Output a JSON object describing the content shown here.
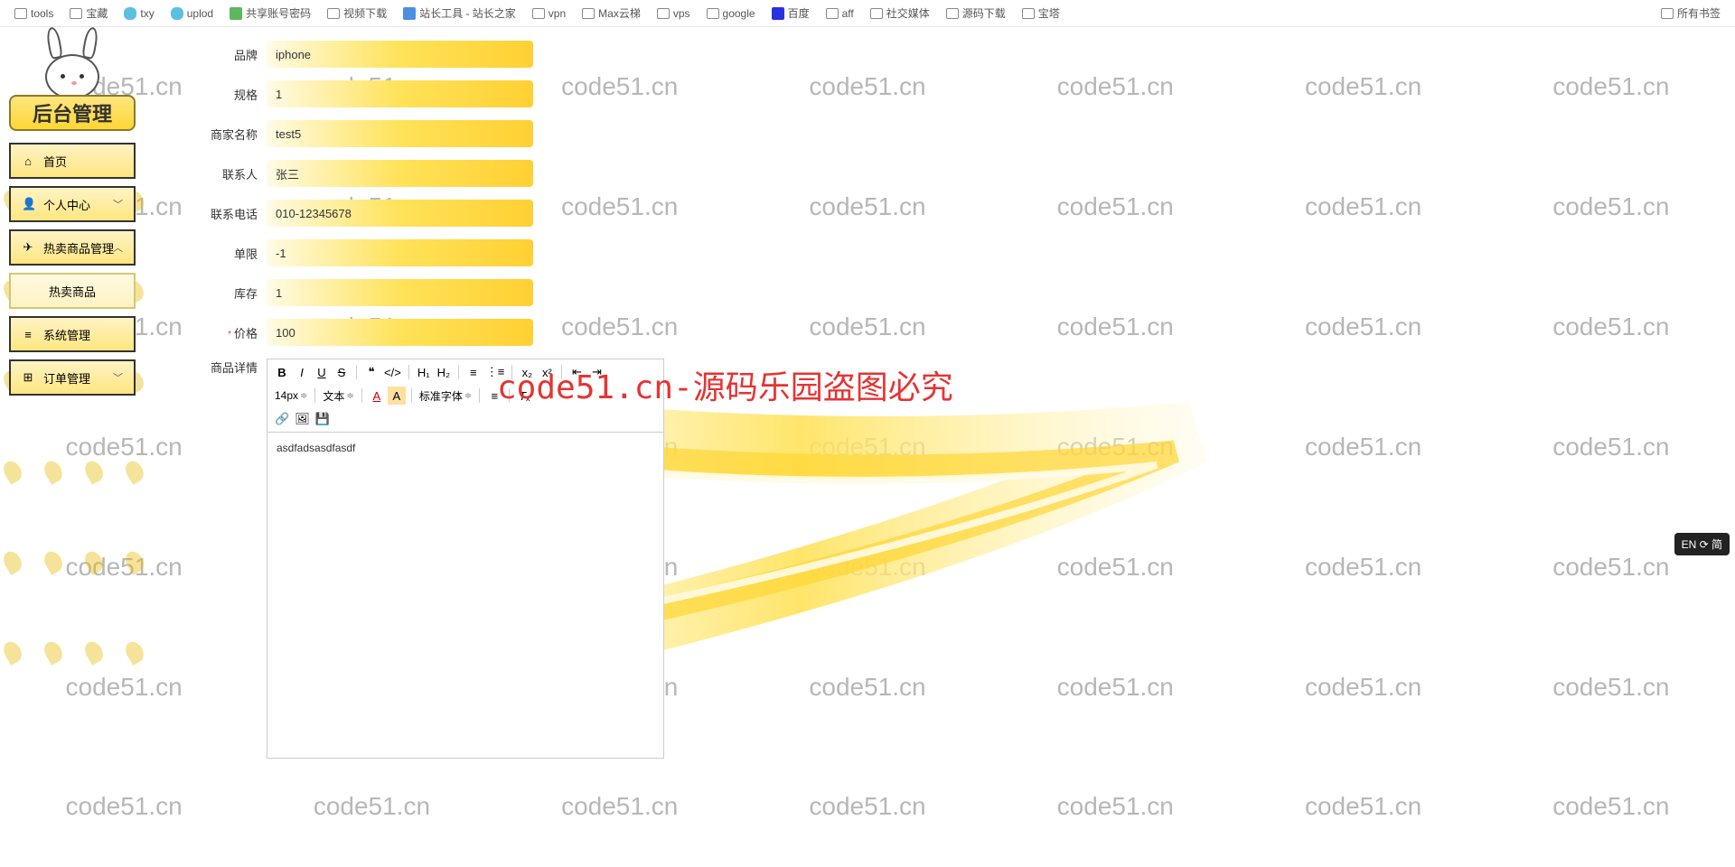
{
  "bookmarks": {
    "left": [
      "tools",
      "宝藏",
      "txy",
      "uplod",
      "共享账号密码",
      "视频下载",
      "站长工具 - 站长之家",
      "vpn",
      "Max云梯",
      "vps",
      "google",
      "百度",
      "aff",
      "社交媒体",
      "源码下载",
      "宝塔"
    ],
    "icons": [
      "folder",
      "folder",
      "teal",
      "teal",
      "green",
      "folder",
      "blue",
      "folder",
      "folder",
      "folder",
      "folder",
      "baidu",
      "folder",
      "folder",
      "folder",
      "folder"
    ],
    "right": "所有书签"
  },
  "sidebar": {
    "title": "后台管理",
    "items": [
      {
        "icon": "⌂",
        "label": "首页",
        "chev": ""
      },
      {
        "icon": "👤",
        "label": "个人中心",
        "chev": "﹀"
      },
      {
        "icon": "✈",
        "label": "热卖商品管理",
        "chev": "︿"
      },
      {
        "icon": "",
        "label": "热卖商品",
        "chev": "",
        "sub": true
      },
      {
        "icon": "≡",
        "label": "系统管理",
        "chev": ""
      },
      {
        "icon": "⊞",
        "label": "订单管理",
        "chev": "﹀"
      }
    ]
  },
  "form": {
    "brand": {
      "label": "品牌",
      "value": "iphone"
    },
    "spec": {
      "label": "规格",
      "value": "1"
    },
    "seller": {
      "label": "商家名称",
      "value": "test5"
    },
    "contact": {
      "label": "联系人",
      "value": "张三"
    },
    "phone": {
      "label": "联系电话",
      "value": "010-12345678"
    },
    "limit": {
      "label": "单限",
      "value": "-1"
    },
    "stock": {
      "label": "库存",
      "value": "1"
    },
    "price": {
      "label": "价格",
      "value": "100"
    },
    "detail": {
      "label": "商品详情"
    }
  },
  "editor": {
    "fontSize": "14px",
    "textType": "文本",
    "fontFamily": "标准字体",
    "content": "asdfadsasdfasdf"
  },
  "watermark": "code51.cn",
  "bigWatermark": "code51.cn-源码乐园盗图必究",
  "ime": "EN ⟳ 简"
}
